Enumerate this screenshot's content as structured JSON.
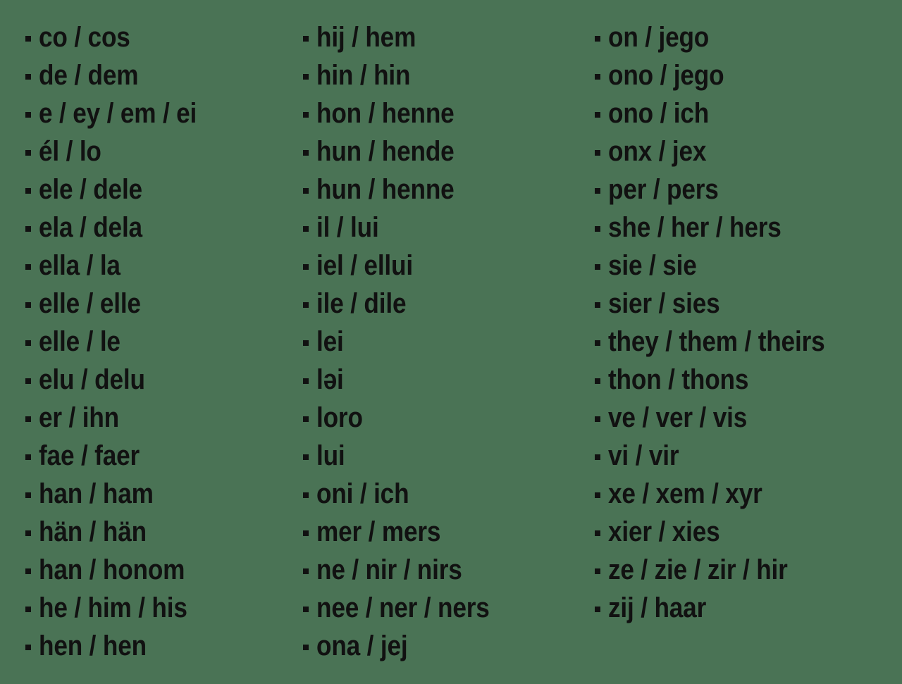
{
  "page": {
    "background_color": "#4a7355",
    "text_color": "#111111",
    "bullet_glyph": "small-square-bullet"
  },
  "columns": [
    {
      "name": "column-1",
      "items": [
        {
          "label": "co / cos"
        },
        {
          "label": "de / dem"
        },
        {
          "label": "e / ey / em / ei"
        },
        {
          "label": "él / lo"
        },
        {
          "label": "ele / dele"
        },
        {
          "label": "ela / dela"
        },
        {
          "label": "ella / la"
        },
        {
          "label": "elle / elle"
        },
        {
          "label": "elle / le"
        },
        {
          "label": "elu / delu"
        },
        {
          "label": "er / ihn"
        },
        {
          "label": "fae / faer"
        },
        {
          "label": "han / ham"
        },
        {
          "label": "hän / hän"
        },
        {
          "label": "han / honom"
        },
        {
          "label": "he / him / his"
        },
        {
          "label": "hen / hen"
        }
      ]
    },
    {
      "name": "column-2",
      "items": [
        {
          "label": "hij / hem"
        },
        {
          "label": "hin / hin"
        },
        {
          "label": "hon / henne"
        },
        {
          "label": "hun / hende"
        },
        {
          "label": "hun / henne"
        },
        {
          "label": "il / lui"
        },
        {
          "label": "iel / ellui"
        },
        {
          "label": "ile / dile"
        },
        {
          "label": "lei"
        },
        {
          "label": "ləi"
        },
        {
          "label": "loro"
        },
        {
          "label": "lui"
        },
        {
          "label": "oni / ich"
        },
        {
          "label": "mer / mers"
        },
        {
          "label": "ne / nir / nirs"
        },
        {
          "label": "nee / ner / ners"
        },
        {
          "label": "ona / jej"
        }
      ]
    },
    {
      "name": "column-3",
      "items": [
        {
          "label": "on / jego"
        },
        {
          "label": "ono / jego"
        },
        {
          "label": "ono / ich"
        },
        {
          "label": "onx / jex"
        },
        {
          "label": "per / pers"
        },
        {
          "label": "she / her / hers"
        },
        {
          "label": "sie / sie"
        },
        {
          "label": "sier / sies"
        },
        {
          "label": "they / them / theirs"
        },
        {
          "label": "thon / thons"
        },
        {
          "label": "ve / ver / vis"
        },
        {
          "label": "vi / vir"
        },
        {
          "label": "xe / xem / xyr"
        },
        {
          "label": "xier / xies"
        },
        {
          "label": "ze / zie / zir / hir"
        },
        {
          "label": "zij / haar"
        }
      ]
    }
  ]
}
